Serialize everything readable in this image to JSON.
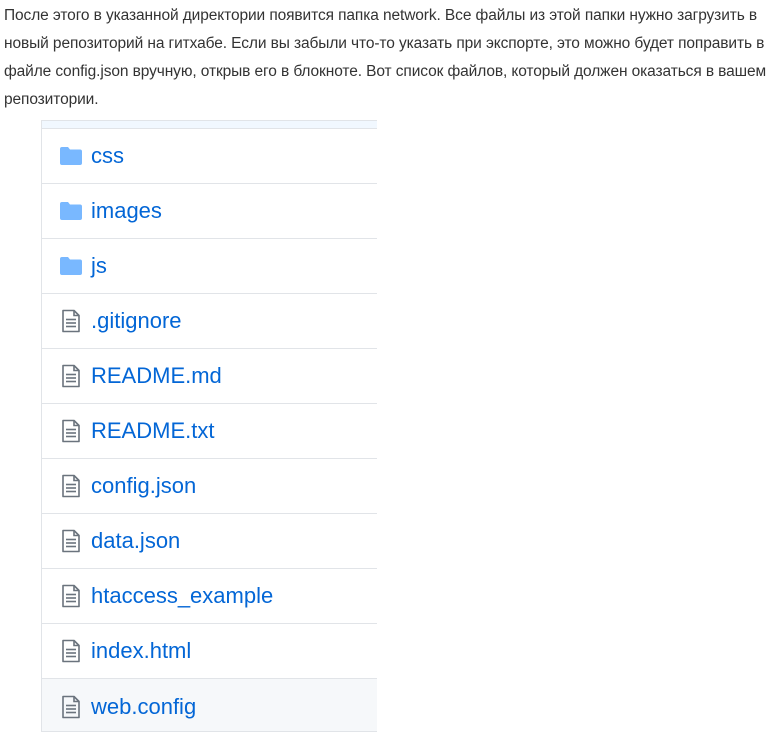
{
  "intro_text": "После этого в указанной директории появится папка network. Все файлы из этой папки нужно загрузить в новый репозиторий на гитхабе. Если вы забыли что-то указать при экспорте, это можно будет поправить в файле config.json вручную, открыв его в блокноте. Вот список файлов, который должен оказаться в вашем репозитории.",
  "colors": {
    "link": "#0366d6",
    "folder_icon": "#79b8ff",
    "file_icon": "#6a737d",
    "border": "#e1e4e8",
    "hover_row": "#f6f8fa"
  },
  "files": [
    {
      "name": "css",
      "icon": "folder-icon"
    },
    {
      "name": "images",
      "icon": "folder-icon"
    },
    {
      "name": "js",
      "icon": "folder-icon"
    },
    {
      "name": ".gitignore",
      "icon": "file-icon"
    },
    {
      "name": "README.md",
      "icon": "file-icon"
    },
    {
      "name": "README.txt",
      "icon": "file-icon"
    },
    {
      "name": "config.json",
      "icon": "file-icon"
    },
    {
      "name": "data.json",
      "icon": "file-icon"
    },
    {
      "name": "htaccess_example",
      "icon": "file-icon"
    },
    {
      "name": "index.html",
      "icon": "file-icon"
    },
    {
      "name": "web.config",
      "icon": "file-icon"
    }
  ]
}
